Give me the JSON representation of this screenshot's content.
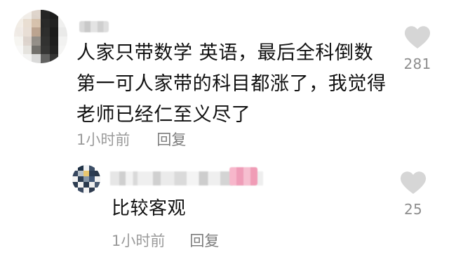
{
  "comment": {
    "text": "人家只带数学 英语，最后全科倒数第一可人家带的科目都涨了，我觉得老师已经仁至义尽了",
    "time": "1小时前",
    "reply_label": "回复",
    "like_count": "281"
  },
  "reply": {
    "text": "比较客观",
    "time": "1小时前",
    "reply_label": "回复",
    "like_count": "25"
  },
  "icons": {
    "like": "heart-icon"
  },
  "colors": {
    "text": "#111111",
    "muted": "#9b9b9b",
    "icon": "#d6d6d6"
  }
}
